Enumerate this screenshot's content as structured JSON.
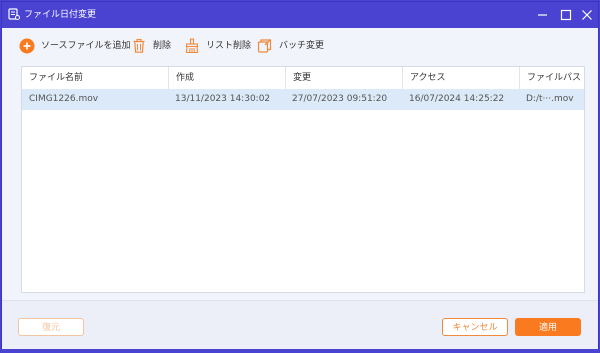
{
  "window": {
    "title": "ファイル日付変更",
    "colors": {
      "titlebar": "#4a43d2",
      "accent": "#f97a1f"
    }
  },
  "toolbar": {
    "add_source": "ソースファイルを追加",
    "delete": "削除",
    "list_delete": "リスト削除",
    "batch_change": "バッチ変更"
  },
  "table": {
    "columns": [
      "ファイル名前",
      "作成",
      "変更",
      "アクセス",
      "ファイルパスー"
    ],
    "rows": [
      {
        "name": "CIMG1226.mov",
        "created": "13/11/2023 14:30:02",
        "modified": "27/07/2023 09:51:20",
        "accessed": "16/07/2024 14:25:22",
        "path": "D:/t···.mov"
      }
    ]
  },
  "footer": {
    "reset": "復元",
    "cancel": "キャンセル",
    "apply": "適用"
  }
}
